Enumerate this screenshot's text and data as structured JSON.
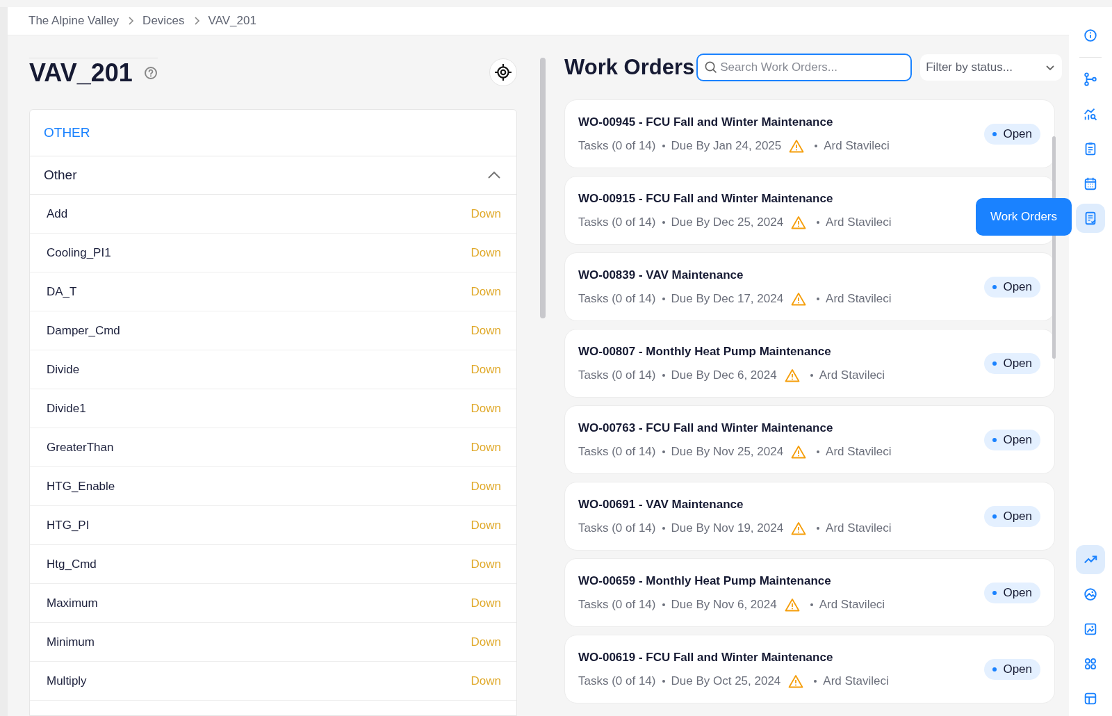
{
  "breadcrumb": [
    "The Alpine Valley",
    "Devices",
    "VAV_201"
  ],
  "device": {
    "title": "VAV_201"
  },
  "points": {
    "category": "OTHER",
    "group": {
      "label": "Other",
      "expanded": true
    },
    "rows": [
      {
        "name": "Add",
        "status": "Down"
      },
      {
        "name": "Cooling_PI1",
        "status": "Down"
      },
      {
        "name": "DA_T",
        "status": "Down"
      },
      {
        "name": "Damper_Cmd",
        "status": "Down"
      },
      {
        "name": "Divide",
        "status": "Down"
      },
      {
        "name": "Divide1",
        "status": "Down"
      },
      {
        "name": "GreaterThan",
        "status": "Down"
      },
      {
        "name": "HTG_Enable",
        "status": "Down"
      },
      {
        "name": "HTG_PI",
        "status": "Down"
      },
      {
        "name": "Htg_Cmd",
        "status": "Down"
      },
      {
        "name": "Maximum",
        "status": "Down"
      },
      {
        "name": "Minimum",
        "status": "Down"
      },
      {
        "name": "Multiply",
        "status": "Down"
      }
    ]
  },
  "work_orders": {
    "title": "Work Orders",
    "search": {
      "placeholder": "Search Work Orders..."
    },
    "filter": {
      "placeholder": "Filter by status..."
    },
    "items": [
      {
        "title": "WO-00945 - FCU Fall and Winter Maintenance",
        "tasks": "Tasks (0 of 14)",
        "due": "Due By Jan 24, 2025",
        "warning": true,
        "assignee": "Ard Stavileci",
        "status": "Open"
      },
      {
        "title": "WO-00915 - FCU Fall and Winter Maintenance",
        "tasks": "Tasks (0 of 14)",
        "due": "Due By Dec 25, 2024",
        "warning": true,
        "assignee": "Ard Stavileci"
      },
      {
        "title": "WO-00839 - VAV Maintenance",
        "tasks": "Tasks (0 of 14)",
        "due": "Due By Dec 17, 2024",
        "warning": true,
        "assignee": "Ard Stavileci",
        "status": "Open"
      },
      {
        "title": "WO-00807 - Monthly Heat Pump Maintenance",
        "tasks": "Tasks (0 of 14)",
        "due": "Due By Dec 6, 2024",
        "warning": true,
        "assignee": "Ard Stavileci",
        "status": "Open"
      },
      {
        "title": "WO-00763 - FCU Fall and Winter Maintenance",
        "tasks": "Tasks (0 of 14)",
        "due": "Due By Nov 25, 2024",
        "warning": true,
        "assignee": "Ard Stavileci",
        "status": "Open"
      },
      {
        "title": "WO-00691 - VAV Maintenance",
        "tasks": "Tasks (0 of 14)",
        "due": "Due By Nov 19, 2024",
        "warning": true,
        "assignee": "Ard Stavileci",
        "status": "Open"
      },
      {
        "title": "WO-00659 - Monthly Heat Pump Maintenance",
        "tasks": "Tasks (0 of 14)",
        "due": "Due By Nov 6, 2024",
        "warning": true,
        "assignee": "Ard Stavileci",
        "status": "Open"
      },
      {
        "title": "WO-00619 - FCU Fall and Winter Maintenance",
        "tasks": "Tasks (0 of 14)",
        "due": "Due By Oct 25, 2024",
        "warning": true,
        "assignee": "Ard Stavileci",
        "status": "Open"
      }
    ]
  },
  "sidebar": {
    "top": [
      {
        "kind": "info",
        "selected": false
      },
      {
        "kind": "branch",
        "selected": false
      },
      {
        "kind": "analytics",
        "selected": false
      },
      {
        "kind": "clipboard",
        "selected": false
      },
      {
        "kind": "calendar",
        "selected": false
      },
      {
        "kind": "workorders",
        "selected": true
      }
    ],
    "bottom": [
      {
        "kind": "trend",
        "selected": true
      },
      {
        "kind": "image",
        "selected": false
      },
      {
        "kind": "photo",
        "selected": false
      },
      {
        "kind": "apps",
        "selected": false
      },
      {
        "kind": "layout",
        "selected": false
      }
    ]
  },
  "tooltip": {
    "text": "Work Orders"
  }
}
